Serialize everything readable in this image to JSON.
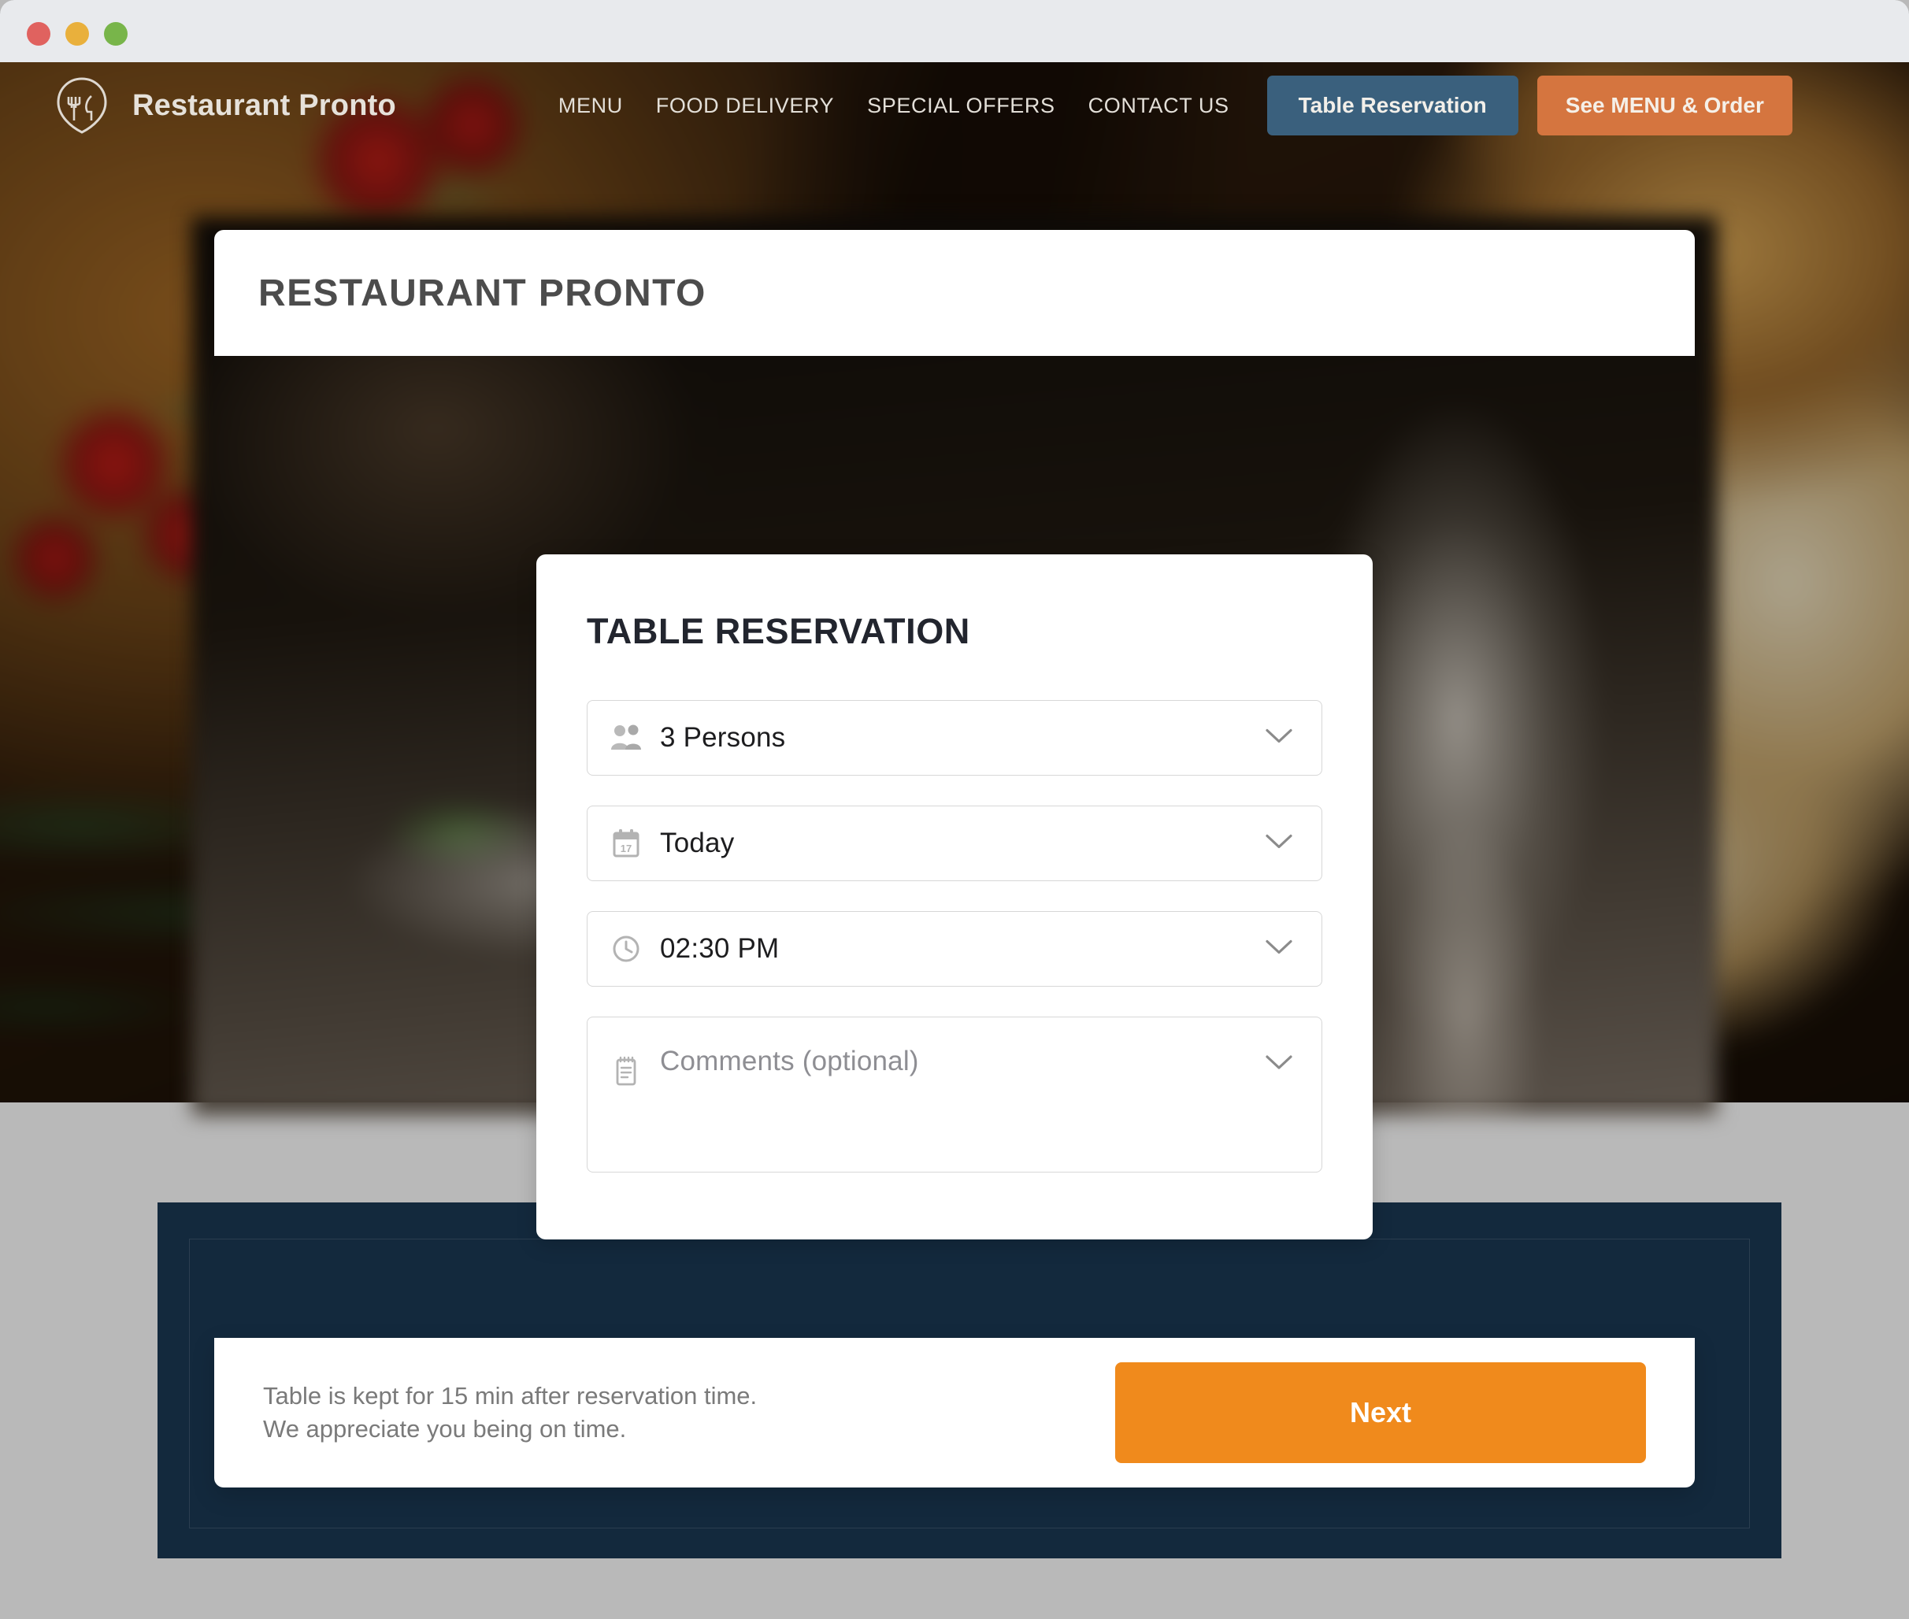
{
  "window": {
    "traffic_lights": [
      {
        "name": "close",
        "color": "#e0625f"
      },
      {
        "name": "minimize",
        "color": "#e9b03c"
      },
      {
        "name": "maximize",
        "color": "#78b54a"
      }
    ]
  },
  "site": {
    "brand_name": "Restaurant Pronto",
    "logo_icon": "fork-knife-leaf-logo-icon",
    "nav_links": [
      {
        "label": "MENU"
      },
      {
        "label": "FOOD DELIVERY"
      },
      {
        "label": "SPECIAL OFFERS"
      },
      {
        "label": "CONTACT US"
      }
    ],
    "cta_reserve": "Table Reservation",
    "cta_order": "See MENU & Order",
    "colors": {
      "reserve_button": "#3a607d",
      "order_button": "#d5753f",
      "next_button": "#f08a1c",
      "dark_section": "#13293d"
    }
  },
  "modal": {
    "header_title": "RESTAURANT PRONTO"
  },
  "reservation": {
    "title": "TABLE RESERVATION",
    "fields": [
      {
        "name": "persons",
        "icon": "people-icon",
        "value": "3 Persons",
        "is_placeholder": false,
        "chevron": "chevron-down-icon"
      },
      {
        "name": "date",
        "icon": "calendar-icon",
        "value": "Today",
        "is_placeholder": false,
        "chevron": "chevron-down-icon"
      },
      {
        "name": "time",
        "icon": "clock-icon",
        "value": "02:30 PM",
        "is_placeholder": false,
        "chevron": "chevron-down-icon"
      },
      {
        "name": "comments",
        "icon": "notes-icon",
        "value": "Comments (optional)",
        "is_placeholder": true,
        "chevron": "chevron-down-icon"
      }
    ]
  },
  "footer": {
    "note_line1": "Table is kept for 15 min after reservation time.",
    "note_line2": "We appreciate you being on time.",
    "next_label": "Next"
  }
}
